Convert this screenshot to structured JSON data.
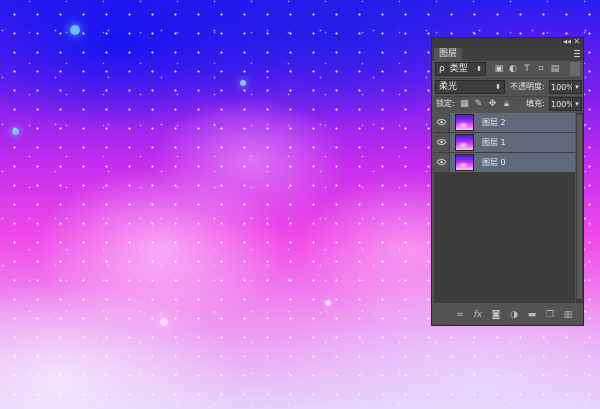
{
  "panel": {
    "tab_label": "图层",
    "collapse_glyph": "◂◂",
    "close_glyph": "✕",
    "filter": {
      "label": "类型",
      "search_glyph": "ρ"
    },
    "blend_mode": "柔光",
    "opacity_label": "不透明度:",
    "opacity_value": "100%",
    "lock_label": "锁定:",
    "fill_label": "填充:",
    "fill_value": "100%",
    "layers": [
      {
        "name": "图层 2"
      },
      {
        "name": "图层 1"
      },
      {
        "name": "图层 0"
      }
    ],
    "bottom_icons": [
      "link-icon",
      "fx-icon",
      "mask-icon",
      "adjustment-icon",
      "folder-icon",
      "new-layer-icon",
      "trash-icon"
    ],
    "fx_label": "fx"
  },
  "colors": {
    "panel_bg": "#535353",
    "selected_layer_bg": "#5e6a7a",
    "canvas_top": "#2a1cf0",
    "canvas_mid": "#f04ae8"
  }
}
